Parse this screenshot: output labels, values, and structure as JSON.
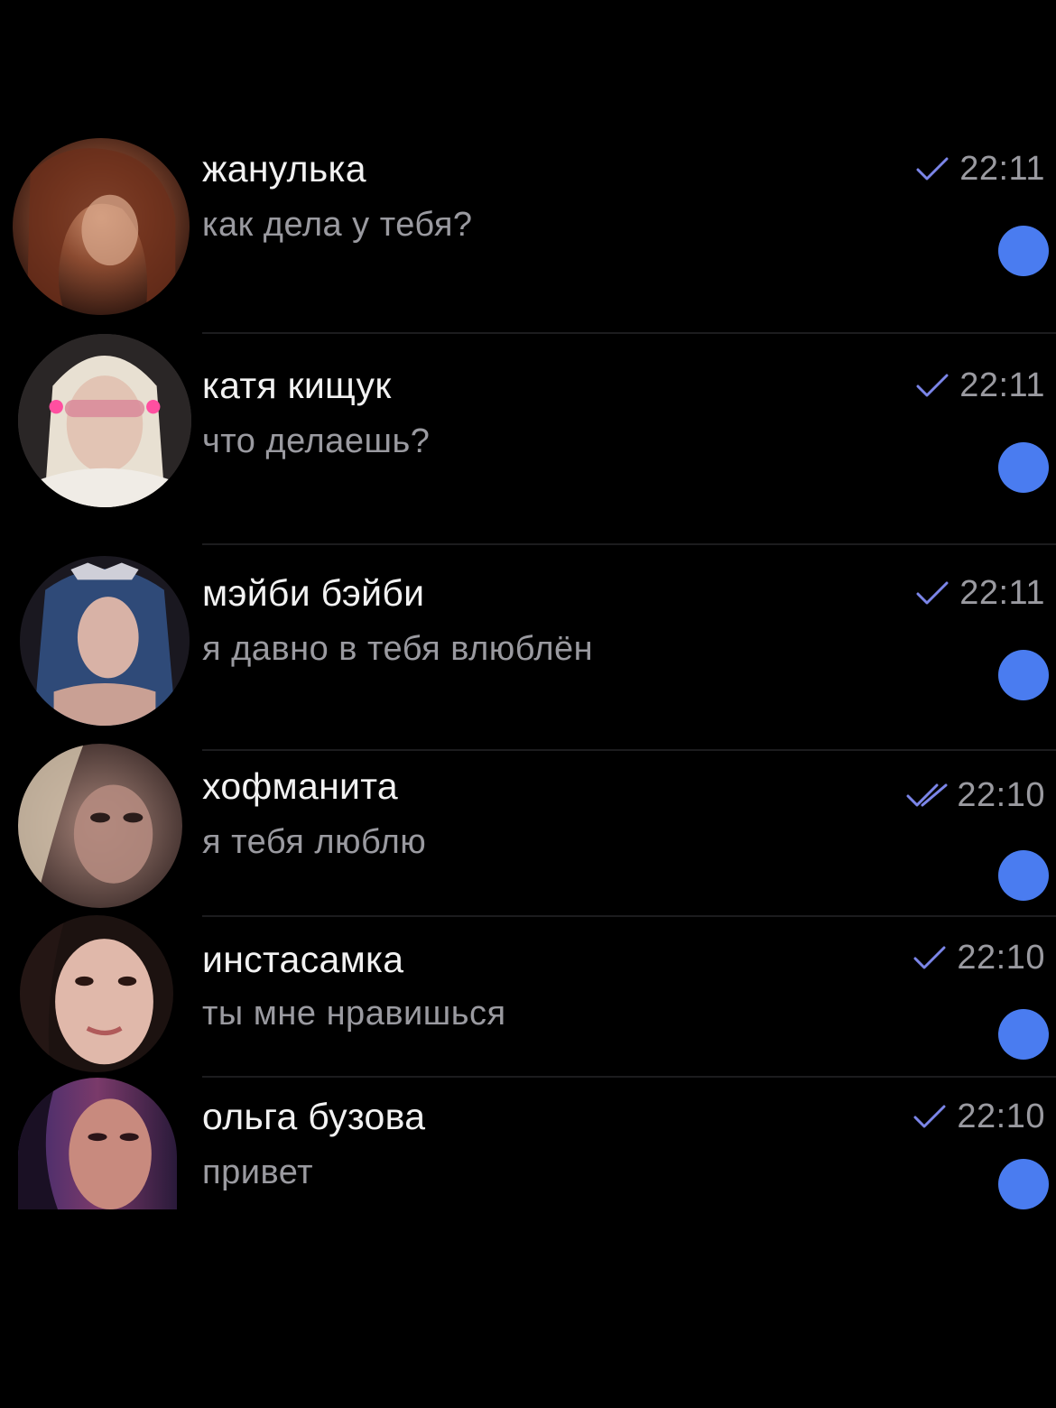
{
  "colors": {
    "background": "#000000",
    "unread": "#4a7cf0",
    "check": "#7b85e8",
    "secondary_text": "#9a9aa0"
  },
  "chats": [
    {
      "name": "жанулька",
      "preview": "как дела у тебя?",
      "time": "22:11",
      "status_icon": "check-icon",
      "unread": true
    },
    {
      "name": "катя кищук",
      "preview": "что делаешь?",
      "time": "22:11",
      "status_icon": "check-icon",
      "unread": true
    },
    {
      "name": "мэйби бэйби",
      "preview": "я давно в тебя влюблён",
      "time": "22:11",
      "status_icon": "check-icon",
      "unread": true
    },
    {
      "name": "хофманита",
      "preview": "я тебя люблю",
      "time": "22:10",
      "status_icon": "double-check-icon",
      "unread": true
    },
    {
      "name": "инстасамка",
      "preview": "ты мне нравишься",
      "time": "22:10",
      "status_icon": "check-icon",
      "unread": true
    },
    {
      "name": "ольга бузова",
      "preview": "привет",
      "time": "22:10",
      "status_icon": "check-icon",
      "unread": true
    }
  ]
}
